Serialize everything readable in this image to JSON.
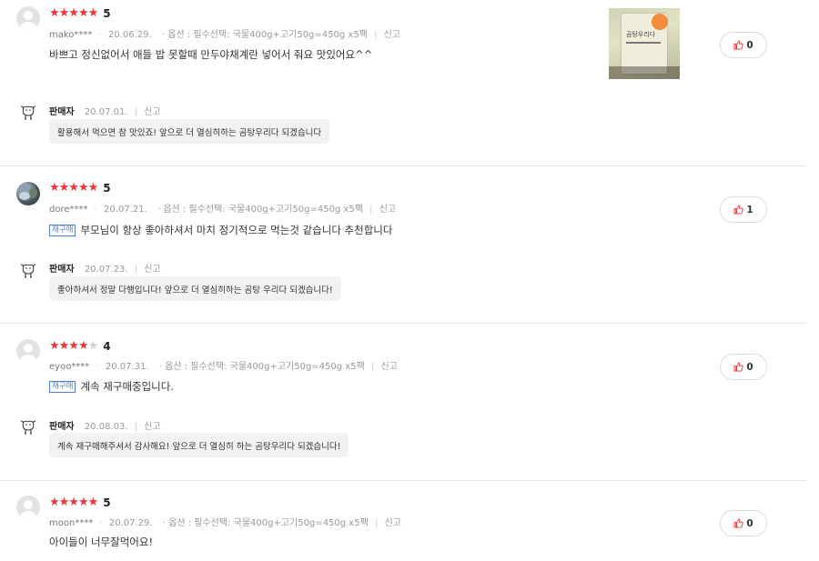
{
  "seller_label": "판매자",
  "report_label": "신고",
  "option_prefix": "· 옵션 : ",
  "reviews": [
    {
      "stars_text": "★★★★★",
      "stars_off_text": "",
      "rating": 5,
      "user": "mako****",
      "date": "20.06.29.",
      "option": "필수선택: 국물400g+고기50g=450g x5팩",
      "badge": "",
      "content": "바쁘고 정신없어서 애들 밥 못할때 만두야채계란 넣어서 줘요 맛있어요^^",
      "likes": 0,
      "has_photo": true,
      "thumb_text": "곰탕우리다",
      "seller_date": "20.07.01.",
      "seller_reply": "활용해서 먹으면 참 맛있죠! 앞으로 더 열심히하는 곰탕우리다 되겠습니다"
    },
    {
      "stars_text": "★★★★★",
      "stars_off_text": "",
      "rating": 5,
      "user": "dore****",
      "date": "20.07.21.",
      "option": "필수선택: 국물400g+고기50g=450g x5팩",
      "badge": "재구매",
      "content": "부모님이 항상 좋아하셔서 마치 정기적으로 먹는것 같습니다 추천합니다",
      "likes": 1,
      "seller_date": "20.07.23.",
      "seller_reply": "좋아하셔서 정말 다행입니다! 앞으로 더 열심히하는 곰탕 우리다 되겠습니다!"
    },
    {
      "stars_text": "★★★★",
      "stars_off_text": "★",
      "rating": 4,
      "user": "eyoo****",
      "date": "20.07.31.",
      "option": "필수선택: 국물400g+고기50g=450g x5팩",
      "badge": "재구매",
      "content": "계속 재구매중입니다.",
      "likes": 0,
      "seller_date": "20.08.03.",
      "seller_reply": "계속 재구매해주셔서 감사해요! 앞으로 더 열심히 하는 곰탕우리다 되겠습니다!"
    },
    {
      "stars_text": "★★★★★",
      "stars_off_text": "",
      "rating": 5,
      "user": "moon****",
      "date": "20.07.29.",
      "option": "필수선택: 국물400g+고기50g=450g x5팩",
      "badge": "",
      "content": "아이들이 너무잘먹어요!",
      "likes": 0
    }
  ]
}
